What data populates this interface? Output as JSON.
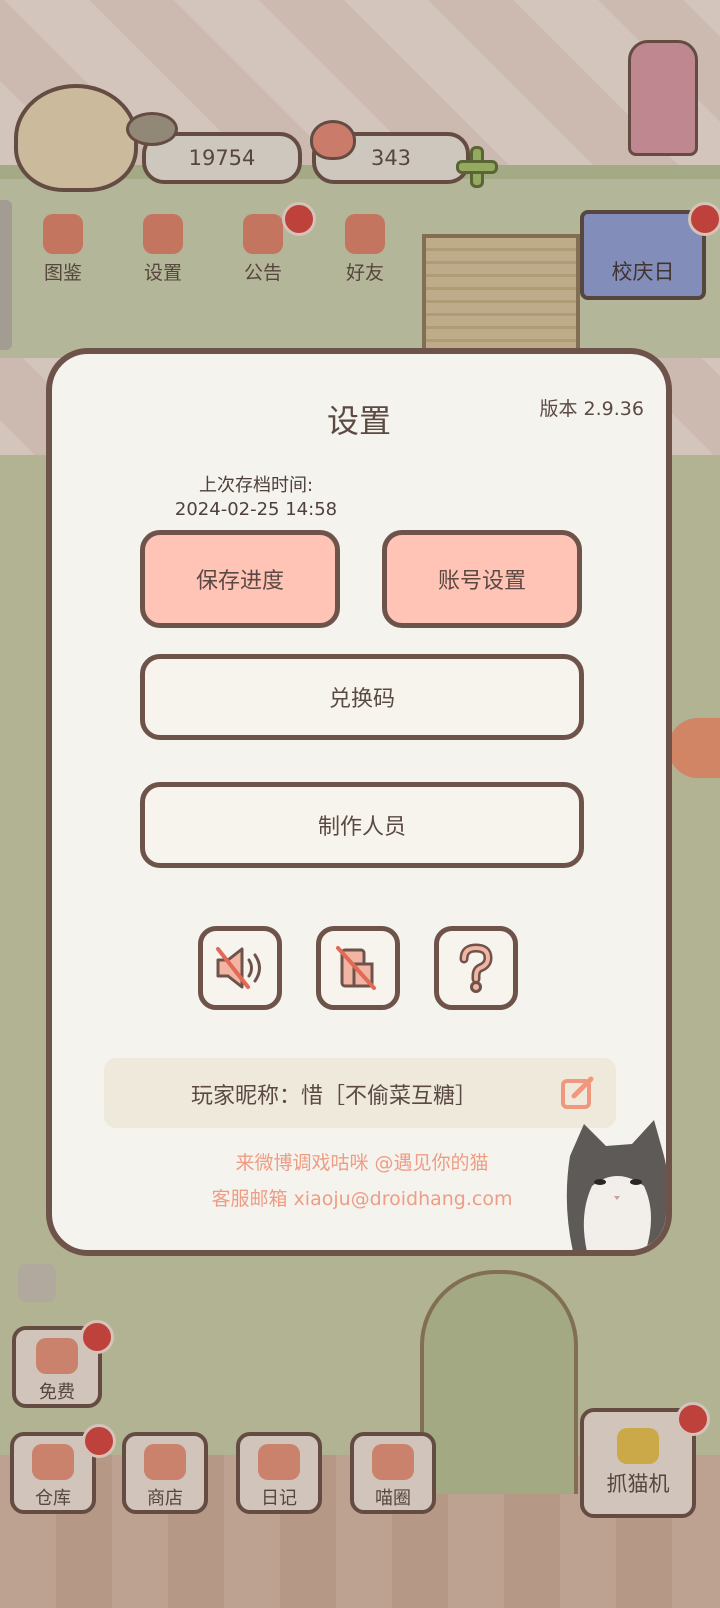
{
  "hud": {
    "coins": "19754",
    "gems": "343"
  },
  "top_menu": [
    {
      "label": "图鉴"
    },
    {
      "label": "设置"
    },
    {
      "label": "公告"
    },
    {
      "label": "好友"
    }
  ],
  "event_banner": {
    "label": "校庆日"
  },
  "dialog": {
    "title": "设置",
    "version": "版本 2.9.36",
    "save_time_label": "上次存档时间:",
    "save_time_value": "2024-02-25 14:58",
    "buttons": {
      "save_progress": "保存进度",
      "account_settings": "账号设置",
      "redeem_code": "兑换码",
      "credits": "制作人员"
    },
    "icons": {
      "sound": "sound-muted-icon",
      "vibration": "vibration-off-icon",
      "help": "question-icon"
    },
    "nickname": "玩家昵称：惜［不偷菜互糖］",
    "weibo": "来微博调戏咕咪 @遇见你的猫",
    "email": "客服邮箱 xiaoju@droidhang.com"
  },
  "bottom_tools": {
    "free": "免费",
    "warehouse": "仓库",
    "shop": "商店",
    "diary": "日记",
    "circle": "喵圈",
    "claw_machine": "抓猫机"
  },
  "colors": {
    "dialog_border": "#6e534b",
    "pink_button": "#ffc4b6",
    "notification_dot": "#d9443f",
    "footer_text": "#ee9d85"
  }
}
